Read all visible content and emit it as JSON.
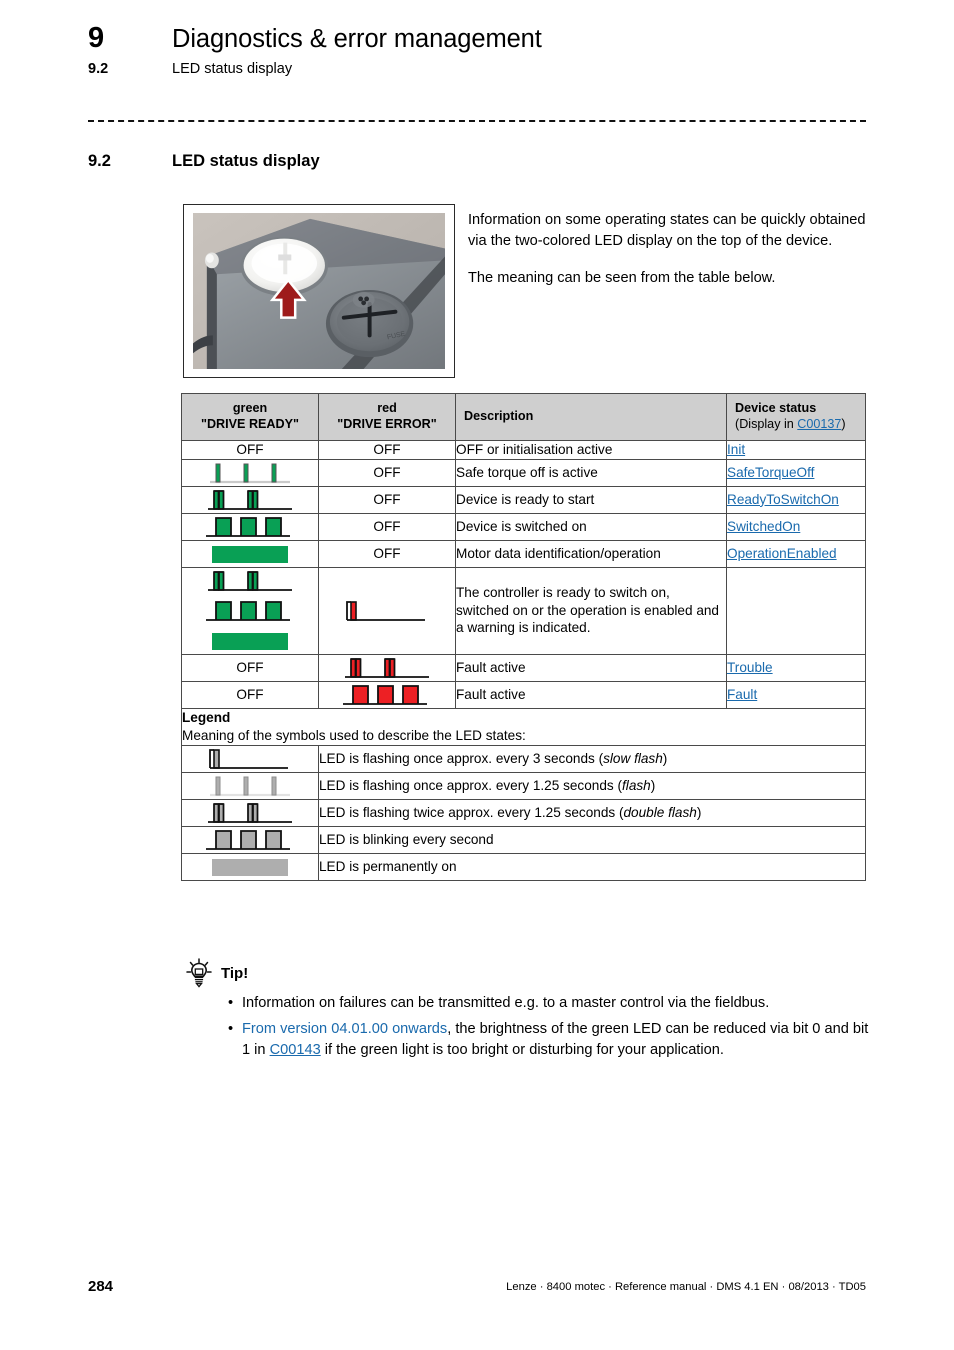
{
  "header": {
    "chapter_number": "9",
    "chapter_title": "Diagnostics & error management",
    "section_number": "9.2",
    "section_title": "LED status display"
  },
  "section": {
    "number": "9.2",
    "title": "LED status display"
  },
  "intro": {
    "paragraph1": "Information on some operating states can be quickly obtained via the two-colored LED display on the top of the device.",
    "paragraph2": "The meaning can be seen from the table below."
  },
  "photo": {
    "caption": "device-top-led-photo"
  },
  "table": {
    "headers": {
      "green": "green",
      "green_sub": "\"DRIVE READY\"",
      "red": "red",
      "red_sub": "\"DRIVE ERROR\"",
      "description": "Description",
      "device_status": "Device status",
      "device_status_sub_pre": "(Display in ",
      "device_status_link": "C00137",
      "device_status_sub_post": ")"
    },
    "rows": [
      {
        "green": "OFF",
        "green_type": "text",
        "red": "OFF",
        "red_type": "text",
        "description": "OFF or initialisation active",
        "status": "Init"
      },
      {
        "green": "flash",
        "green_type": "symbol",
        "red": "OFF",
        "red_type": "text",
        "description": "Safe torque off is active",
        "status": "SafeTorqueOff"
      },
      {
        "green": "double-flash",
        "green_type": "symbol",
        "red": "OFF",
        "red_type": "text",
        "description": "Device is ready to start",
        "status": "ReadyToSwitchOn"
      },
      {
        "green": "blink",
        "green_type": "symbol",
        "red": "OFF",
        "red_type": "text",
        "description": "Device is switched on",
        "status": "SwitchedOn"
      },
      {
        "green": "on",
        "green_type": "symbol",
        "red": "OFF",
        "red_type": "text",
        "description": "Motor data identification/operation",
        "status": "OperationEnabled"
      },
      {
        "green": "double-flash,blink,on",
        "green_type": "symbol-stack",
        "red": "slow-flash",
        "red_type": "symbol",
        "description": "The controller is ready to switch on, switched on or the operation is enabled and a warning is indicated.",
        "status": ""
      },
      {
        "green": "OFF",
        "green_type": "text",
        "red": "double-flash",
        "red_type": "symbol",
        "description": "Fault active",
        "status": "Trouble"
      },
      {
        "green": "OFF",
        "green_type": "text",
        "red": "blink",
        "red_type": "symbol",
        "description": "Fault active",
        "status": "Fault"
      }
    ],
    "legend": {
      "title": "Legend",
      "subtitle": "Meaning of the symbols used to describe the LED states:",
      "rows": [
        {
          "symbol": "slow-flash",
          "text_pre": "LED is flashing once approx. every 3 seconds (",
          "text_em": "slow flash",
          "text_post": ")"
        },
        {
          "symbol": "flash",
          "text_pre": "LED is flashing once approx. every 1.25 seconds (",
          "text_em": "flash",
          "text_post": ")"
        },
        {
          "symbol": "double-flash",
          "text_pre": "LED is flashing twice approx. every 1.25 seconds (",
          "text_em": "double flash",
          "text_post": ")"
        },
        {
          "symbol": "blink",
          "text_pre": "LED is blinking every second",
          "text_em": "",
          "text_post": ""
        },
        {
          "symbol": "on",
          "text_pre": "LED is permanently on",
          "text_em": "",
          "text_post": ""
        }
      ]
    }
  },
  "tip": {
    "icon": "lightbulb-icon",
    "title": "Tip!",
    "bullet1": "Information on failures can be transmitted e.g. to a master control via the fieldbus.",
    "bullet2_link": "From version 04.01.00 onwards",
    "bullet2_mid": ", the brightness of the green LED can be reduced via bit 0 and bit 1 in ",
    "bullet2_ref": "C00143",
    "bullet2_end": " if the green light is too bright or disturbing for your application."
  },
  "footer": {
    "page_number": "284",
    "info": "Lenze · 8400 motec · Reference manual · DMS 4.1 EN · 08/2013 · TD05"
  },
  "colors": {
    "led_green": "#09a055",
    "led_red": "#ed2024",
    "led_gray": "#aeaeae",
    "link_blue": "#1a6aad",
    "header_bg": "#cfcfcf"
  }
}
